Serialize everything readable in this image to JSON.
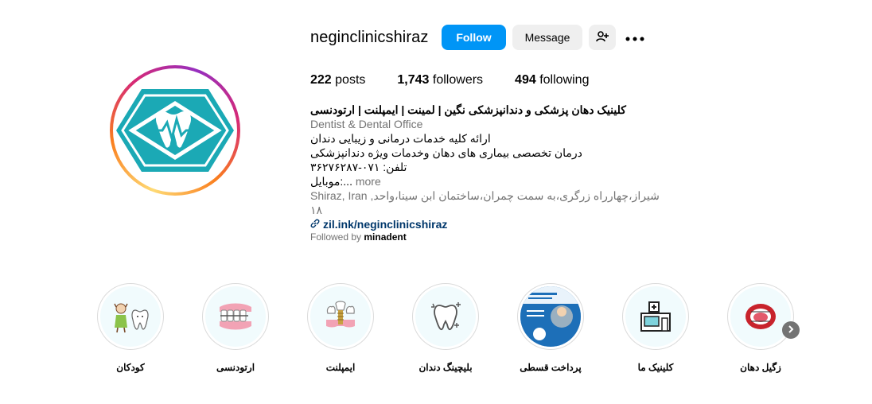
{
  "profile": {
    "username": "neginclinicshiraz",
    "follow_label": "Follow",
    "message_label": "Message",
    "add_user_icon": "add-user-icon",
    "more_icon": "more-options-icon",
    "avatar_icon": "clinic-logo"
  },
  "stats": {
    "posts_count": "222",
    "posts_label": "posts",
    "followers_count": "1,743",
    "followers_label": "followers",
    "following_count": "494",
    "following_label": "following"
  },
  "bio": {
    "title": "کلینیک دهان پزشکی و دندانپزشکی نگین | لمینت | ایمپلنت | ارتودنسی",
    "category": "Dentist & Dental Office",
    "line1": "ارائه کلیه خدمات درمانی و زیبایی دندان",
    "line2": "درمان تخصصی بیماری های دهان وخدمات ویژه دندانپزشکی",
    "line3": "تلفن: ۰۷۱-۳۶۲۷۶۲۸۷",
    "line4": "موبایل:...",
    "more": "more",
    "location": "Shiraz, Iran ,شیراز،چهارراه زرگری،به سمت چمران،ساختمان ابن سینا،واحد ۱۸",
    "link": "zil.ink/neginclinicshiraz",
    "followed_by_prefix": "Followed by",
    "followed_by_user": "minadent"
  },
  "highlights": [
    {
      "label": "زگیل دهان",
      "icon": "mouth-icon"
    },
    {
      "label": "کلینیک ما",
      "icon": "clinic-building-icon"
    },
    {
      "label": "پرداخت قسطی",
      "icon": "installment-photo"
    },
    {
      "label": "بلیچینگ دندان",
      "icon": "tooth-whitening-icon"
    },
    {
      "label": "ایمپلنت",
      "icon": "implant-icon"
    },
    {
      "label": "ارتودنسی",
      "icon": "braces-icon"
    },
    {
      "label": "کودکان",
      "icon": "kids-tooth-icon"
    }
  ],
  "colors": {
    "primary": "#0095f6",
    "logo_teal": "#1ba9b5",
    "muted": "#737373",
    "link": "#00376b"
  }
}
